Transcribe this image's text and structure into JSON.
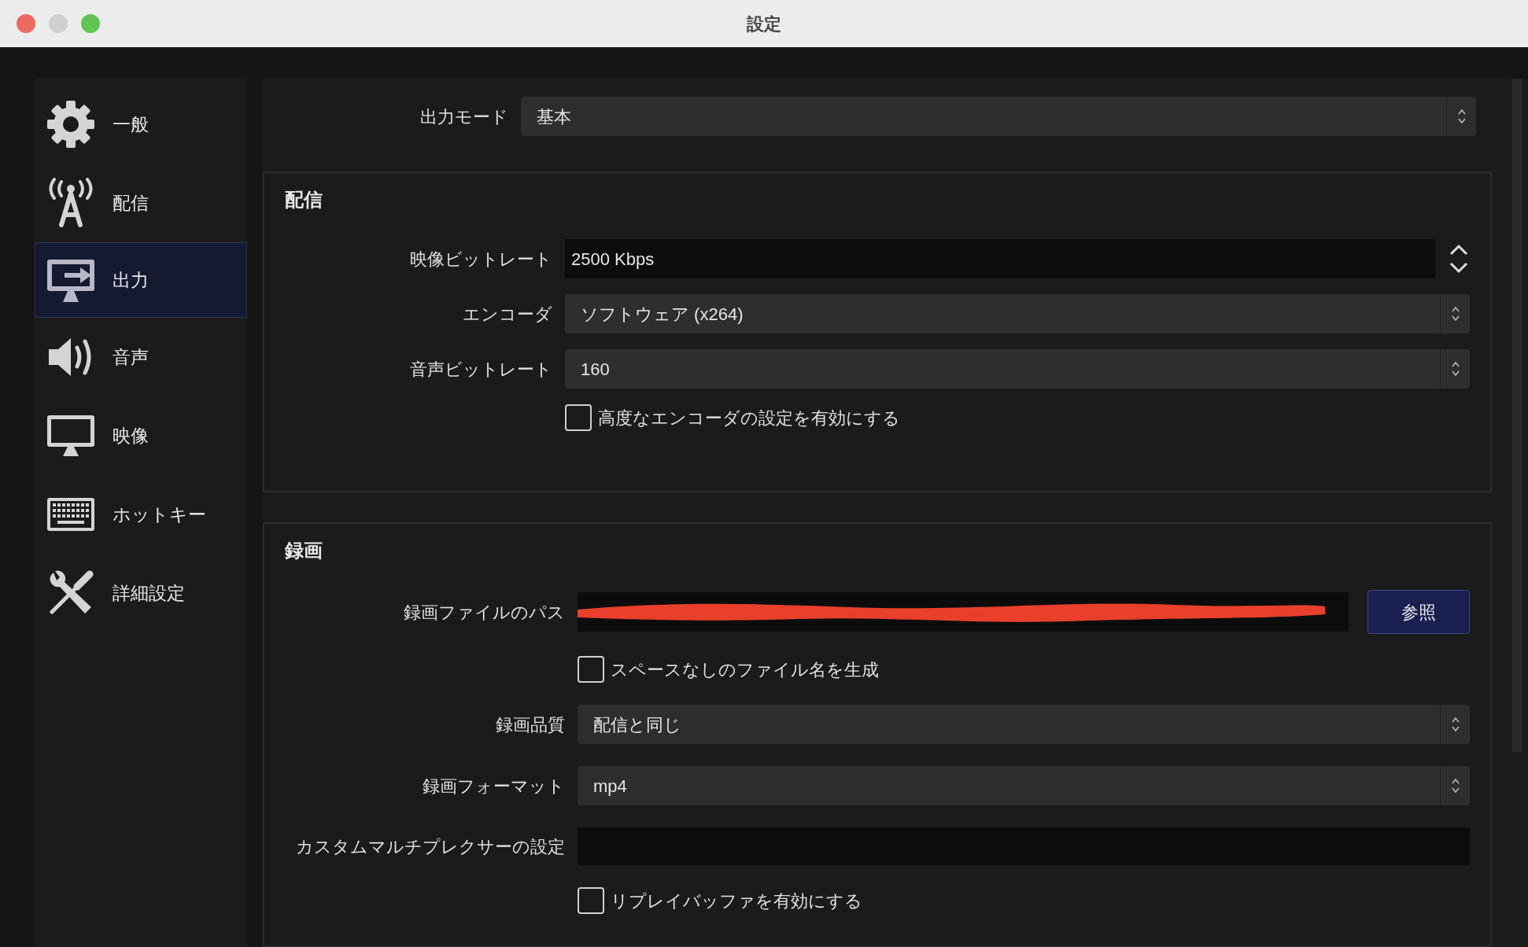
{
  "window": {
    "title": "設定"
  },
  "sidebar": {
    "items": [
      {
        "label": "一般",
        "selected": false
      },
      {
        "label": "配信",
        "selected": false
      },
      {
        "label": "出力",
        "selected": true
      },
      {
        "label": "音声",
        "selected": false
      },
      {
        "label": "映像",
        "selected": false
      },
      {
        "label": "ホットキー",
        "selected": false
      },
      {
        "label": "詳細設定",
        "selected": false
      }
    ]
  },
  "output_mode": {
    "label": "出力モード",
    "value": "基本"
  },
  "groups": [
    {
      "title": "配信",
      "rows": [
        {
          "kind": "spin",
          "label": "映像ビットレート",
          "value": "2500 Kbps"
        },
        {
          "kind": "select",
          "label": "エンコーダ",
          "value": "ソフトウェア (x264)"
        },
        {
          "kind": "select",
          "label": "音声ビットレート",
          "value": "160"
        },
        {
          "kind": "checkbox",
          "label": "高度なエンコーダの設定を有効にする",
          "checked": false
        }
      ]
    },
    {
      "title": "録画",
      "rows": [
        {
          "kind": "path",
          "label": "録画ファイルのパス",
          "redacted": true,
          "button": "参照"
        },
        {
          "kind": "checkbox",
          "label": "スペースなしのファイル名を生成",
          "checked": false
        },
        {
          "kind": "select",
          "label": "録画品質",
          "value": "配信と同じ"
        },
        {
          "kind": "select",
          "label": "録画フォーマット",
          "value": "mp4"
        },
        {
          "kind": "text",
          "label": "カスタムマルチプレクサーの設定"
        },
        {
          "kind": "checkbox",
          "label": "リプレイバッファを有効にする",
          "checked": false
        }
      ]
    }
  ]
}
